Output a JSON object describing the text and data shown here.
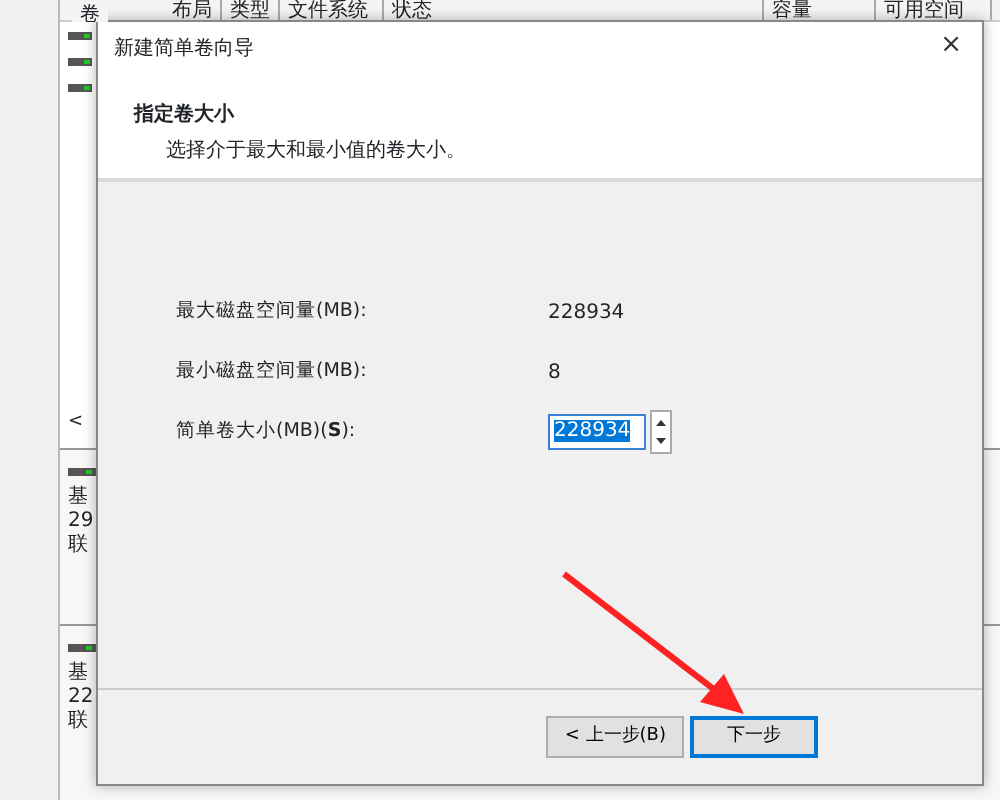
{
  "background_window": {
    "columns": [
      "卷",
      "布局",
      "类型",
      "文件系统",
      "状态",
      "容量",
      "可用空间"
    ],
    "disks": [
      {
        "type": "基",
        "size": "29",
        "status": "联"
      },
      {
        "type": "基",
        "size": "22",
        "status": "联"
      }
    ],
    "scroll_left": "<"
  },
  "dialog": {
    "title": "新建简单卷向导",
    "close": "×",
    "heading": "指定卷大小",
    "subtitle": "选择介于最大和最小值的卷大小。",
    "fields": [
      {
        "kind": "text",
        "label": "最大磁盘空间量(MB):",
        "value": "228934"
      },
      {
        "kind": "text",
        "label": "最小磁盘空间量(MB):",
        "value": "8"
      },
      {
        "kind": "spin",
        "label": "简单卷大小(MB)(**S**):",
        "value": "228934",
        "text_selected": true
      }
    ],
    "buttons": [
      {
        "label": "< 上一步(B)",
        "focused": false
      },
      {
        "label": "下一步",
        "focused": true
      }
    ]
  }
}
